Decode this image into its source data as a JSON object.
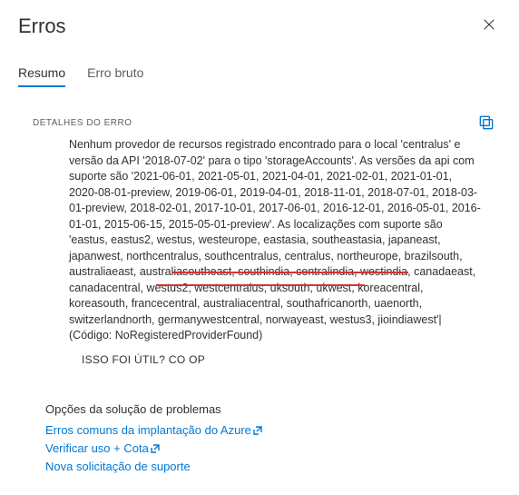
{
  "header": {
    "title": "Erros"
  },
  "tabs": {
    "summary": "Resumo",
    "raw": "Erro bruto"
  },
  "details": {
    "label": "DETALHES DO ERRO",
    "message": "Nenhum provedor de recursos registrado encontrado para o local 'centralus' e versão da API '2018-07-02' para o tipo 'storageAccounts'. As versões da api com suporte são '2021-06-01, 2021-05-01, 2021-04-01, 2021-02-01, 2021-01-01, 2020-08-01-preview, 2019-06-01, 2019-04-01, 2018-11-01, 2018-07-01, 2018-03-01-preview, 2018-02-01, 2017-10-01, 2017-06-01, 2016-12-01, 2016-05-01, 2016-01-01, 2015-06-15, 2015-05-01-preview'. As localizações com suporte são 'eastus, eastus2, westus, westeurope, eastasia, southeastasia, japaneast, japanwest, northcentralus, southcentralus, centralus, northeurope, brazilsouth, australiaeast, australiasoutheast, southindia, centralindia, westindia, canadaeast, canadacentral, westus2, westcentralus, uksouth, ukwest, koreacentral, koreasouth, francecentral, australiacentral, southafricanorth, uaenorth, switzerlandnorth, germanywestcentral, norwayeast, westus3, jioindiawest'| (Código: NoRegisteredProviderFound)"
  },
  "feedback": {
    "prompt": "ISSO FOI ÚTIL? CO OP"
  },
  "troubleshoot": {
    "title": "Opções da solução de problemas",
    "links": {
      "commonErrors": "Erros comuns da implantação do Azure",
      "checkUsage": "Verificar uso + ",
      "quota": "Cota",
      "newRequest": "Nova solicitação de suporte"
    }
  }
}
